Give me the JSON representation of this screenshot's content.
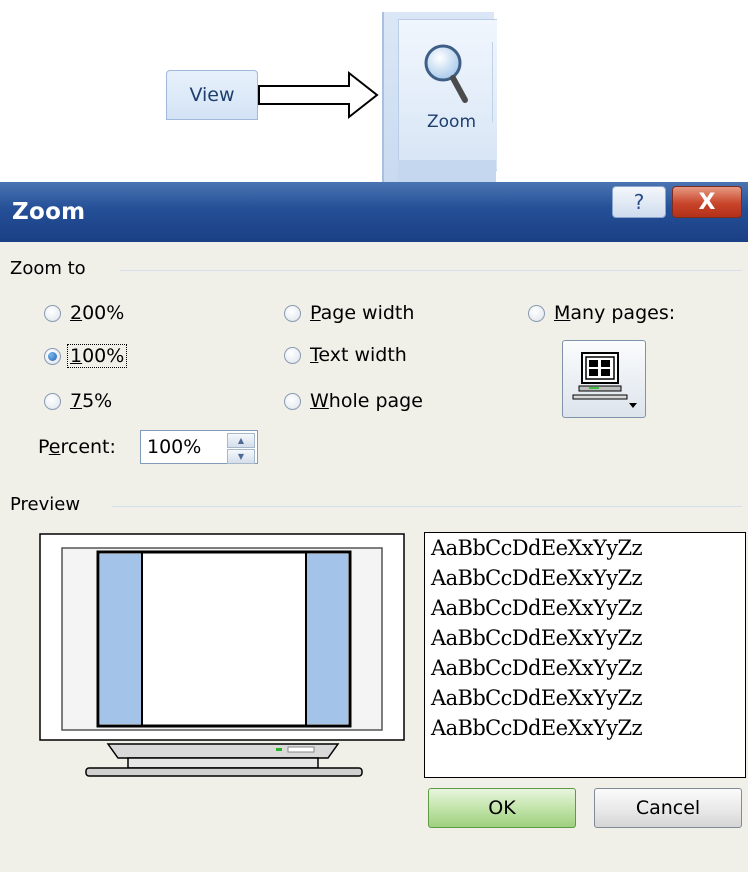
{
  "ribbon": {
    "view_tab": "View",
    "zoom_button": "Zoom"
  },
  "dialog": {
    "title": "Zoom",
    "help_glyph": "?",
    "close_glyph": "X",
    "zoom_to": {
      "heading": "Zoom to",
      "options": [
        {
          "pre": "",
          "key": "2",
          "post": "00%",
          "selected": false
        },
        {
          "pre": "",
          "key": "1",
          "post": "00%",
          "selected": true
        },
        {
          "pre": "",
          "key": "7",
          "post": "5%",
          "selected": false
        },
        {
          "pre": "",
          "key": "P",
          "post": "age width",
          "selected": false
        },
        {
          "pre": "",
          "key": "T",
          "post": "ext width",
          "selected": false
        },
        {
          "pre": "",
          "key": "W",
          "post": "hole page",
          "selected": false
        },
        {
          "pre": "",
          "key": "M",
          "post": "any pages:",
          "selected": false
        }
      ],
      "many_pages_icon": "monitor-pages-icon"
    },
    "percent": {
      "label_pre": "P",
      "label_key": "e",
      "label_post": "rcent:",
      "value": "100%"
    },
    "preview": {
      "heading": "Preview",
      "sample_lines": [
        "AaBbCcDdEeXxYyZz",
        "AaBbCcDdEeXxYyZz",
        "AaBbCcDdEeXxYyZz",
        "AaBbCcDdEeXxYyZz",
        "AaBbCcDdEeXxYyZz",
        "AaBbCcDdEeXxYyZz",
        "AaBbCcDdEeXxYyZz"
      ]
    },
    "buttons": {
      "ok": "OK",
      "cancel": "Cancel"
    }
  },
  "colors": {
    "title_bar": "#244f97",
    "close_button": "#c8452a",
    "ok_button": "#bfe2a6",
    "preview_margin": "#a3c3e8"
  }
}
